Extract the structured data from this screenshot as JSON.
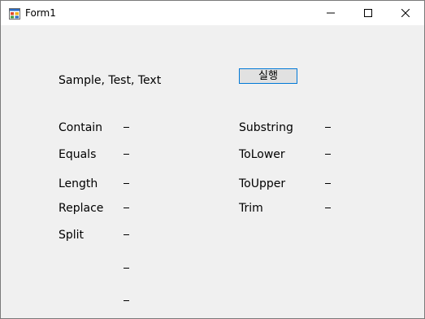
{
  "window": {
    "title": "Form1"
  },
  "controls": {
    "input_text": "Sample, Test, Text",
    "run_button": "실행"
  },
  "left_column": [
    {
      "label": "Contain",
      "value": "–"
    },
    {
      "label": "Equals",
      "value": "–"
    },
    {
      "label": "Length",
      "value": "–"
    },
    {
      "label": "Replace",
      "value": "–"
    },
    {
      "label": "Split",
      "value": "–"
    }
  ],
  "right_column": [
    {
      "label": "Substring",
      "value": "–"
    },
    {
      "label": "ToLower",
      "value": "–"
    },
    {
      "label": "ToUpper",
      "value": "–"
    },
    {
      "label": "Trim",
      "value": "–"
    }
  ],
  "extra_values": [
    "–",
    "–"
  ]
}
